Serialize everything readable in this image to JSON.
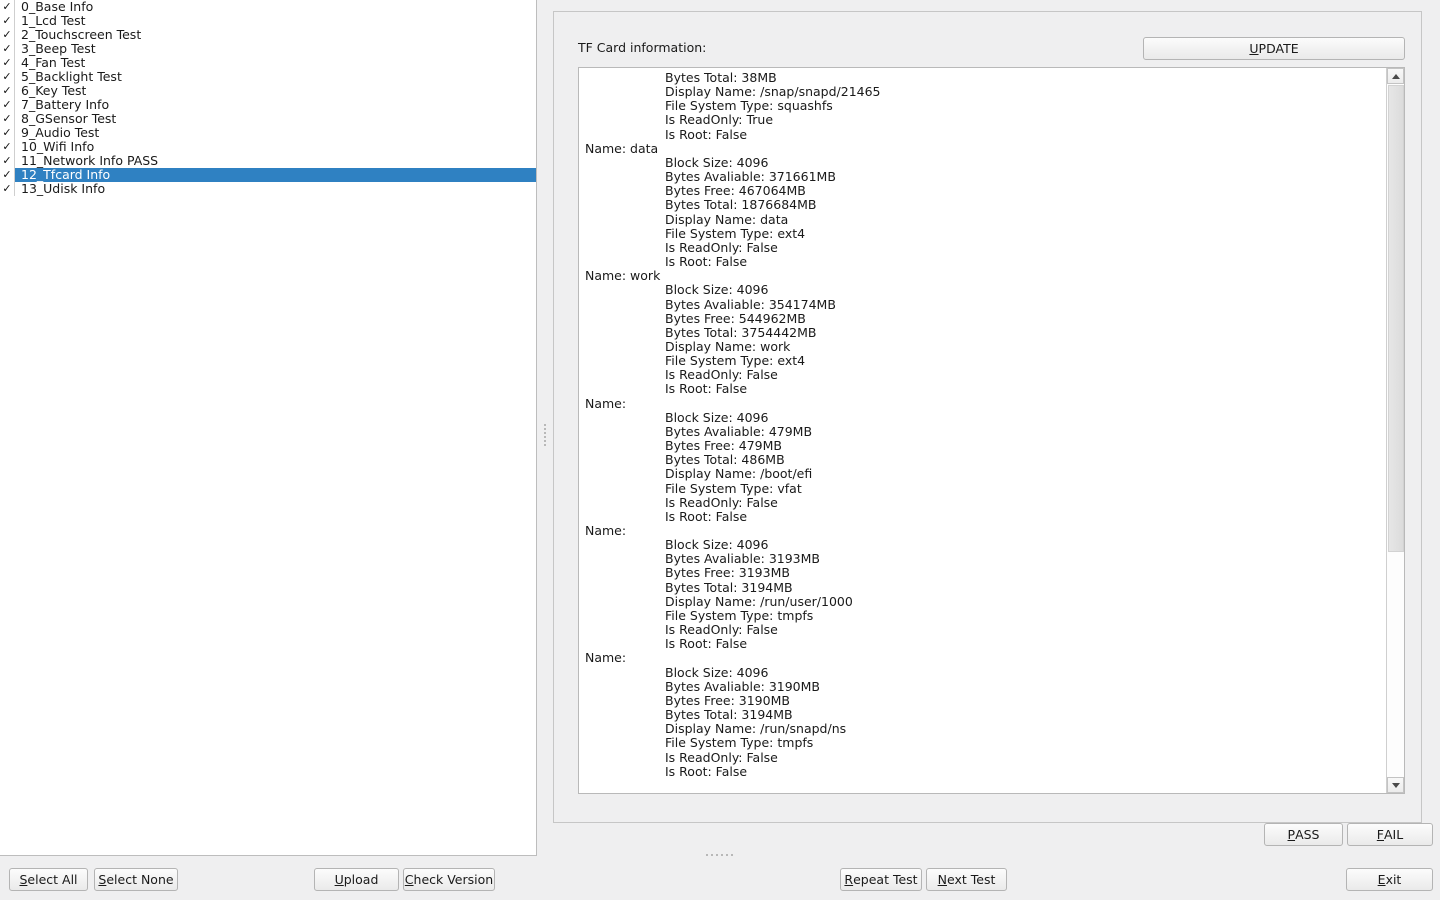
{
  "sidebar": {
    "checkmark_glyph": "✓",
    "selected_index": 12,
    "items": [
      {
        "label": "0_Base Info",
        "checked": true
      },
      {
        "label": "1_Lcd Test",
        "checked": true
      },
      {
        "label": "2_Touchscreen Test",
        "checked": true
      },
      {
        "label": "3_Beep Test",
        "checked": true
      },
      {
        "label": "4_Fan Test",
        "checked": true
      },
      {
        "label": "5_Backlight Test",
        "checked": true
      },
      {
        "label": "6_Key Test",
        "checked": true
      },
      {
        "label": "7_Battery Info",
        "checked": true
      },
      {
        "label": "8_GSensor Test",
        "checked": true
      },
      {
        "label": "9_Audio Test",
        "checked": true
      },
      {
        "label": "10_Wifi Info",
        "checked": true
      },
      {
        "label": "11_Network Info PASS",
        "checked": true
      },
      {
        "label": "12_Tfcard Info",
        "checked": true
      },
      {
        "label": "13_Udisk Info",
        "checked": true
      }
    ]
  },
  "panel": {
    "header_label": "TF Card information:",
    "update_button": {
      "mnemonic": "U",
      "rest": "PDATE"
    }
  },
  "info": {
    "lines": [
      {
        "indent": "detail",
        "text": "Bytes Total: 38MB"
      },
      {
        "indent": "detail",
        "text": "Display Name: /snap/snapd/21465"
      },
      {
        "indent": "detail",
        "text": "File System Type: squashfs"
      },
      {
        "indent": "detail",
        "text": "Is ReadOnly: True"
      },
      {
        "indent": "detail",
        "text": "Is Root: False"
      },
      {
        "indent": "name",
        "text": "Name: data"
      },
      {
        "indent": "detail",
        "text": "Block Size: 4096"
      },
      {
        "indent": "detail",
        "text": "Bytes Avaliable: 371661MB"
      },
      {
        "indent": "detail",
        "text": "Bytes Free: 467064MB"
      },
      {
        "indent": "detail",
        "text": "Bytes Total: 1876684MB"
      },
      {
        "indent": "detail",
        "text": "Display Name: data"
      },
      {
        "indent": "detail",
        "text": "File System Type: ext4"
      },
      {
        "indent": "detail",
        "text": "Is ReadOnly: False"
      },
      {
        "indent": "detail",
        "text": "Is Root: False"
      },
      {
        "indent": "name",
        "text": "Name: work"
      },
      {
        "indent": "detail",
        "text": "Block Size: 4096"
      },
      {
        "indent": "detail",
        "text": "Bytes Avaliable: 354174MB"
      },
      {
        "indent": "detail",
        "text": "Bytes Free: 544962MB"
      },
      {
        "indent": "detail",
        "text": "Bytes Total: 3754442MB"
      },
      {
        "indent": "detail",
        "text": "Display Name: work"
      },
      {
        "indent": "detail",
        "text": "File System Type: ext4"
      },
      {
        "indent": "detail",
        "text": "Is ReadOnly: False"
      },
      {
        "indent": "detail",
        "text": "Is Root: False"
      },
      {
        "indent": "name",
        "text": "Name:"
      },
      {
        "indent": "detail",
        "text": "Block Size: 4096"
      },
      {
        "indent": "detail",
        "text": "Bytes Avaliable: 479MB"
      },
      {
        "indent": "detail",
        "text": "Bytes Free: 479MB"
      },
      {
        "indent": "detail",
        "text": "Bytes Total: 486MB"
      },
      {
        "indent": "detail",
        "text": "Display Name: /boot/efi"
      },
      {
        "indent": "detail",
        "text": "File System Type: vfat"
      },
      {
        "indent": "detail",
        "text": "Is ReadOnly: False"
      },
      {
        "indent": "detail",
        "text": "Is Root: False"
      },
      {
        "indent": "name",
        "text": "Name:"
      },
      {
        "indent": "detail",
        "text": "Block Size: 4096"
      },
      {
        "indent": "detail",
        "text": "Bytes Avaliable: 3193MB"
      },
      {
        "indent": "detail",
        "text": "Bytes Free: 3193MB"
      },
      {
        "indent": "detail",
        "text": "Bytes Total: 3194MB"
      },
      {
        "indent": "detail",
        "text": "Display Name: /run/user/1000"
      },
      {
        "indent": "detail",
        "text": "File System Type: tmpfs"
      },
      {
        "indent": "detail",
        "text": "Is ReadOnly: False"
      },
      {
        "indent": "detail",
        "text": "Is Root: False"
      },
      {
        "indent": "name",
        "text": "Name:"
      },
      {
        "indent": "detail",
        "text": "Block Size: 4096"
      },
      {
        "indent": "detail",
        "text": "Bytes Avaliable: 3190MB"
      },
      {
        "indent": "detail",
        "text": "Bytes Free: 3190MB"
      },
      {
        "indent": "detail",
        "text": "Bytes Total: 3194MB"
      },
      {
        "indent": "detail",
        "text": "Display Name: /run/snapd/ns"
      },
      {
        "indent": "detail",
        "text": "File System Type: tmpfs"
      },
      {
        "indent": "detail",
        "text": "Is ReadOnly: False"
      },
      {
        "indent": "detail",
        "text": "Is Root: False"
      }
    ]
  },
  "scrollbar": {
    "up_arrow_icon": "triangle-up-icon",
    "down_arrow_icon": "triangle-down-icon"
  },
  "buttons": {
    "select_all": {
      "mnemonic": "S",
      "rest": "elect All"
    },
    "select_none": {
      "mnemonic": "S",
      "rest": "elect None"
    },
    "upload": {
      "mnemonic": "U",
      "rest": "pload"
    },
    "check_version": {
      "mnemonic": "C",
      "rest": "heck Version"
    },
    "repeat_test": {
      "mnemonic": "R",
      "rest": "epeat Test"
    },
    "next_test": {
      "mnemonic": "N",
      "rest": "ext Test"
    },
    "exit": {
      "mnemonic": "E",
      "rest": "xit"
    },
    "pass": {
      "mnemonic": "P",
      "rest": "ASS"
    },
    "fail": {
      "mnemonic": "F",
      "rest": "AIL"
    }
  },
  "colors": {
    "selection_blue": "#2f81c2",
    "window_bg": "#efeff0",
    "panel_bg": "#ffffff",
    "text": "#1a1a1a"
  }
}
